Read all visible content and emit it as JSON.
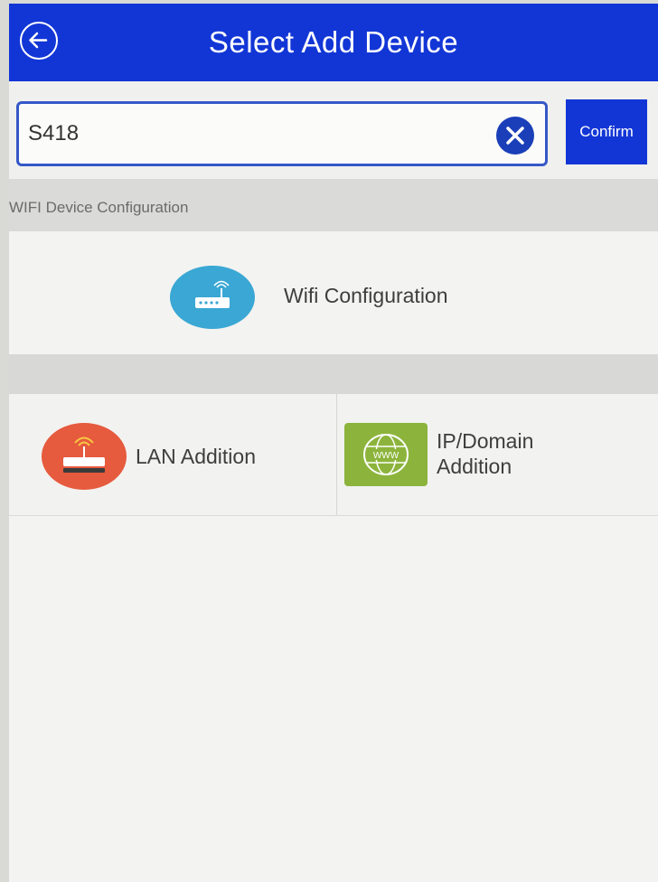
{
  "header": {
    "title": "Select Add Device",
    "back_icon": "arrow-left-circle-icon"
  },
  "search": {
    "value": "S418",
    "clear_icon": "close-circle-icon",
    "confirm_label": "Confirm"
  },
  "sections": {
    "wifi_header": "WIFI Device Configuration"
  },
  "wifi_option": {
    "label": "Wifi Configuration",
    "icon": "router-wifi-icon"
  },
  "lan_option": {
    "label": "LAN Addition",
    "icon": "router-lan-icon"
  },
  "ip_option": {
    "label_line1": "IP/Domain",
    "label_line2": "Addition",
    "icon": "globe-www-icon",
    "icon_text": "WWW"
  },
  "colors": {
    "primary": "#1236d6",
    "wifi_icon_bg": "#3aa7d4",
    "lan_icon_bg": "#e65a3e",
    "ip_icon_bg": "#8cb43c"
  }
}
